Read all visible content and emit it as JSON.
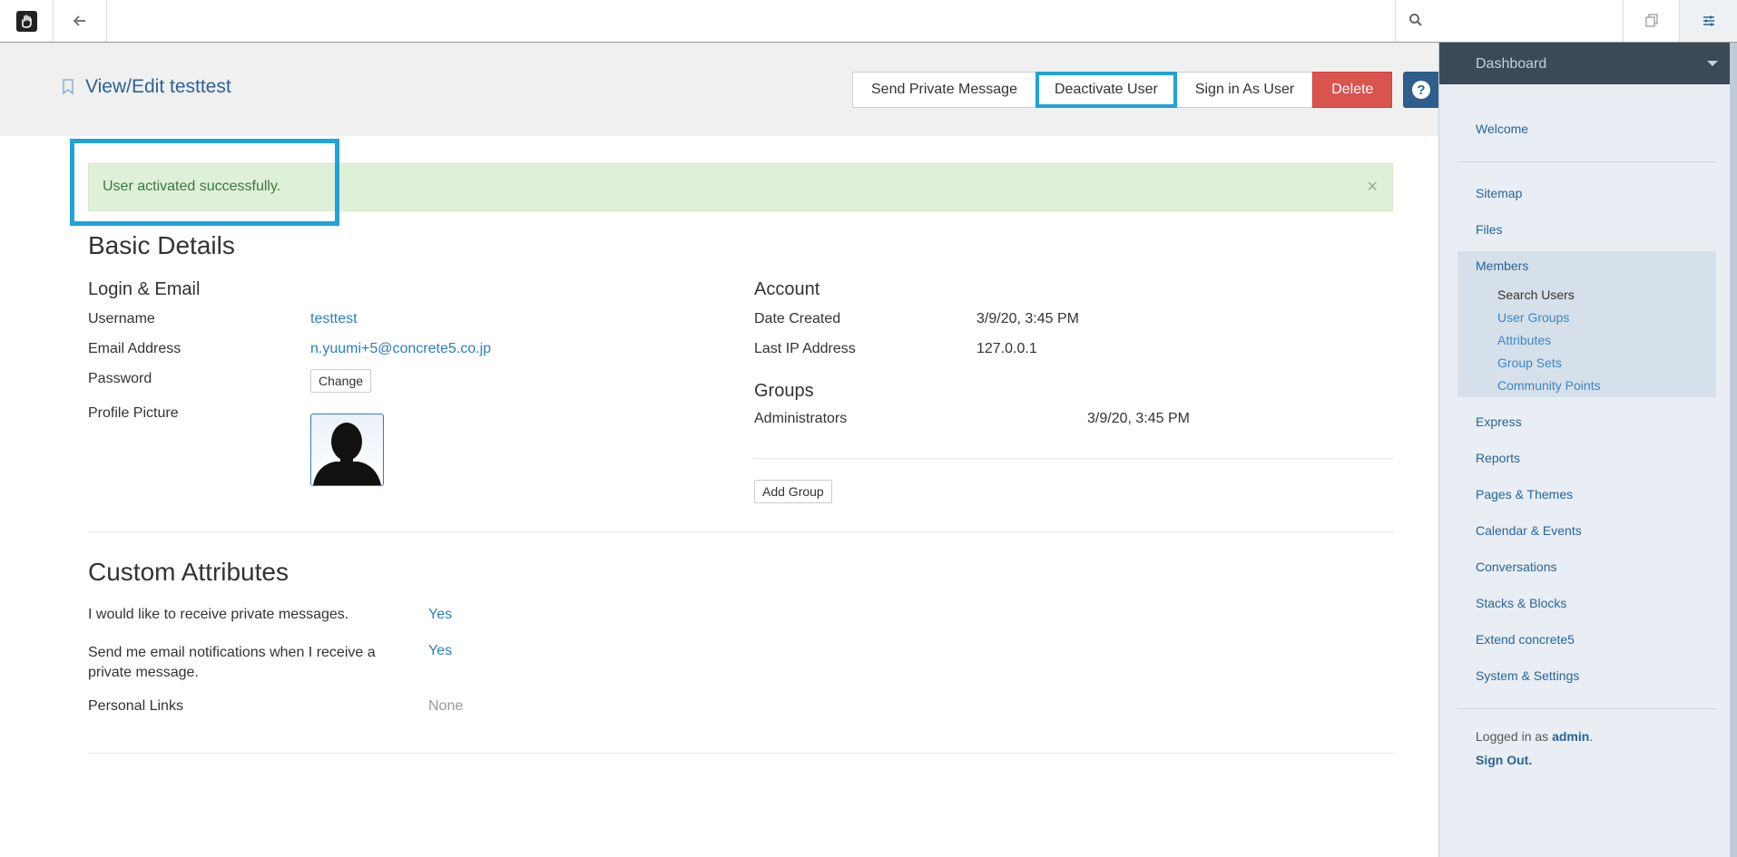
{
  "topbar": {
    "search_placeholder": ""
  },
  "header": {
    "title": "View/Edit testtest",
    "actions": {
      "send_message": "Send Private Message",
      "deactivate": "Deactivate User",
      "sign_in_as": "Sign in As User",
      "delete": "Delete"
    }
  },
  "alert": {
    "message": "User activated successfully.",
    "close": "×"
  },
  "basic": {
    "heading": "Basic Details",
    "login_heading": "Login & Email",
    "username_label": "Username",
    "username_value": "testtest",
    "email_label": "Email Address",
    "email_value": "n.yuumi+5@concrete5.co.jp",
    "password_label": "Password",
    "password_button": "Change",
    "profile_label": "Profile Picture"
  },
  "account": {
    "heading": "Account",
    "date_created_label": "Date Created",
    "date_created_value": "3/9/20, 3:45 PM",
    "last_ip_label": "Last IP Address",
    "last_ip_value": "127.0.0.1"
  },
  "groups": {
    "heading": "Groups",
    "rows": [
      {
        "name": "Administrators",
        "date": "3/9/20, 3:45 PM"
      }
    ],
    "add_button": "Add Group"
  },
  "custom": {
    "heading": "Custom Attributes",
    "rows": [
      {
        "label": "I would like to receive private messages.",
        "value": "Yes"
      },
      {
        "label": "Send me email notifications when I receive a private message.",
        "value": "Yes"
      },
      {
        "label": "Personal Links",
        "value": "None"
      }
    ]
  },
  "sidebar": {
    "header": "Dashboard",
    "items": {
      "welcome": "Welcome",
      "sitemap": "Sitemap",
      "files": "Files",
      "members": "Members",
      "express": "Express",
      "reports": "Reports",
      "pages_themes": "Pages & Themes",
      "calendar": "Calendar & Events",
      "conversations": "Conversations",
      "stacks": "Stacks & Blocks",
      "extend": "Extend concrete5",
      "system": "System & Settings"
    },
    "members_sub": {
      "search_users": "Search Users",
      "user_groups": "User Groups",
      "attributes": "Attributes",
      "group_sets": "Group Sets",
      "community_points": "Community Points"
    },
    "footer": {
      "logged_prefix": "Logged in as",
      "user": "admin",
      "period": ".",
      "sign_out": "Sign Out."
    }
  },
  "colors": {
    "highlight": "#1fa3d8",
    "danger": "#d9534f",
    "link": "#2a7fbf",
    "alert_bg": "#dff0d8"
  }
}
